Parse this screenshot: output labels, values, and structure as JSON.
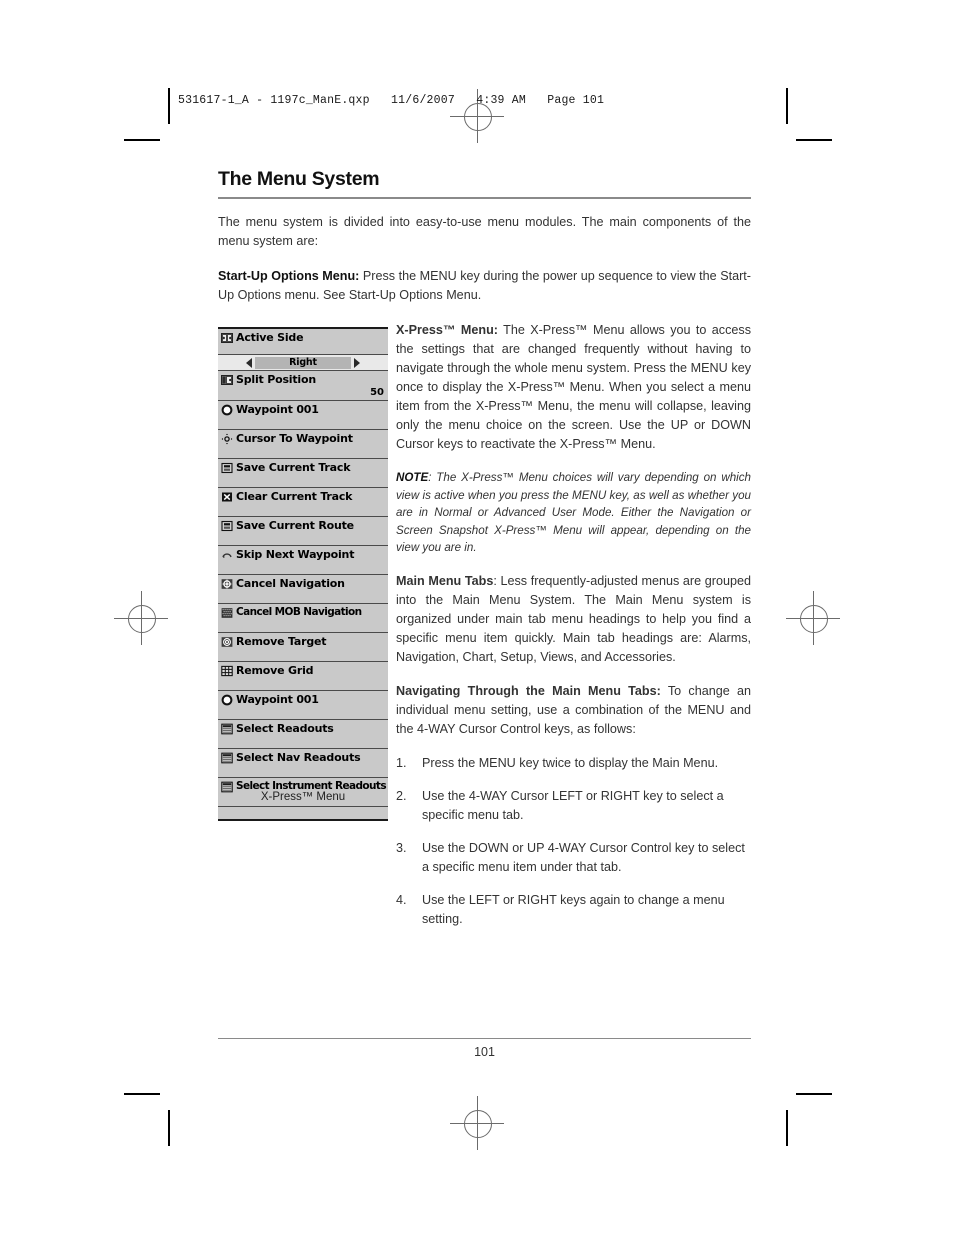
{
  "slug": {
    "text": "531617-1_A - 1197c_ManE.qxp   11/6/2007   4:39 AM   Page 101"
  },
  "page": {
    "title": "The Menu System",
    "intro": "The menu system is divided into easy-to-use menu modules. The main components of the menu system are:",
    "startup": {
      "lead": "Start-Up Options Menu:",
      "body": " Press the MENU key during the power up sequence to view the Start-Up Options menu. See Start-Up Options Menu."
    },
    "folio": "101"
  },
  "xpress": {
    "lead": "X-Press™ Menu:",
    "body": " The X-Press™ Menu allows you to access the settings that are changed frequently without having to navigate through the whole menu system. Press the MENU key once to display the X-Press™ Menu. When you select a menu item from the X-Press™ Menu, the menu will collapse, leaving only the menu choice on the screen. Use the UP or DOWN Cursor keys to reactivate the X-Press™ Menu."
  },
  "note": {
    "lead": "NOTE",
    "body": ": The X-Press™ Menu choices will vary depending on which view is active when you press the MENU key, as well as whether you are in Normal or Advanced User Mode. Either the Navigation or Screen Snapshot X-Press™ Menu will appear, depending on the view you are in."
  },
  "main_menu_tabs": {
    "lead": "Main Menu Tabs",
    "body": ": Less frequently-adjusted menus are grouped into the Main Menu System. The Main Menu system is organized under main tab menu headings to help you find a specific menu item quickly. Main tab headings are: Alarms, Navigation, Chart, Setup, Views, and Accessories."
  },
  "navigating": {
    "lead": "Navigating Through the Main Menu Tabs:",
    "body": " To change an individual menu setting, use a combination of the MENU and the 4-WAY Cursor Control keys, as follows:"
  },
  "steps": [
    {
      "num": "1.",
      "text": "Press the MENU key twice to display the Main Menu."
    },
    {
      "num": "2.",
      "text": "Use the 4-WAY Cursor LEFT or RIGHT key to select a specific menu tab."
    },
    {
      "num": "3.",
      "text": "Use the DOWN or UP 4-WAY Cursor Control key to select a specific menu item under that tab."
    },
    {
      "num": "4.",
      "text": "Use the LEFT or RIGHT keys again to change a menu setting."
    }
  ],
  "menu_screenshot": {
    "caption": "X-Press™ Menu",
    "slider": {
      "value": "Right",
      "left_arrow": "left-triangle",
      "right_arrow": "right-triangle"
    },
    "split_position_value": "50",
    "items": [
      {
        "label": "Active Side",
        "icon": "split-screen-icon"
      },
      {
        "label": "Split Position",
        "icon": "split-position-icon"
      },
      {
        "label": "Waypoint 001",
        "icon": "waypoint-circle-icon"
      },
      {
        "label": "Cursor To Waypoint",
        "icon": "cursor-crosshair-icon"
      },
      {
        "label": "Save Current Track",
        "icon": "save-disk-icon"
      },
      {
        "label": "Clear Current Track",
        "icon": "clear-x-icon"
      },
      {
        "label": "Save Current Route",
        "icon": "save-disk-icon"
      },
      {
        "label": "Skip Next Waypoint",
        "icon": "skip-arc-icon"
      },
      {
        "label": "Cancel Navigation",
        "icon": "cancel-navigation-icon"
      },
      {
        "label": "Cancel MOB Navigation",
        "icon": "mob-grid-icon"
      },
      {
        "label": "Remove Target",
        "icon": "target-icon"
      },
      {
        "label": "Remove Grid",
        "icon": "grid-icon"
      },
      {
        "label": "Waypoint 001",
        "icon": "waypoint-circle-icon"
      },
      {
        "label": "Select Readouts",
        "icon": "readouts-icon"
      },
      {
        "label": "Select Nav Readouts",
        "icon": "readouts-icon"
      },
      {
        "label": "Select Instrument Readouts",
        "icon": "readouts-icon"
      }
    ]
  },
  "colors": {
    "menu_bg": "#c9c9c9",
    "menu_border": "#4a4a4a",
    "slider_track": "#b4b4b4",
    "rule": "#8a8a8a"
  }
}
